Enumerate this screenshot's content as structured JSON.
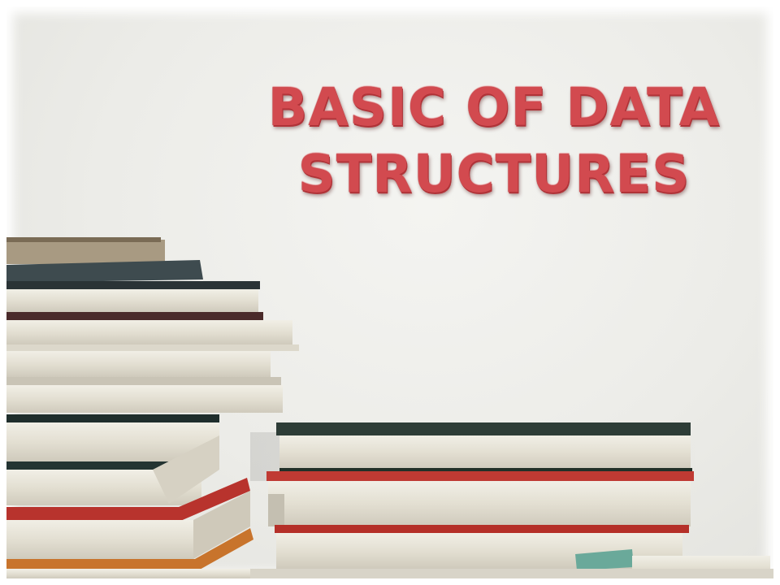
{
  "slide": {
    "title_line1": "BASIC OF DATA",
    "title_line2": "STRUCTURES",
    "title_color": "#d24a4f"
  },
  "illustration": {
    "subject": "stacks-of-books-photo"
  }
}
